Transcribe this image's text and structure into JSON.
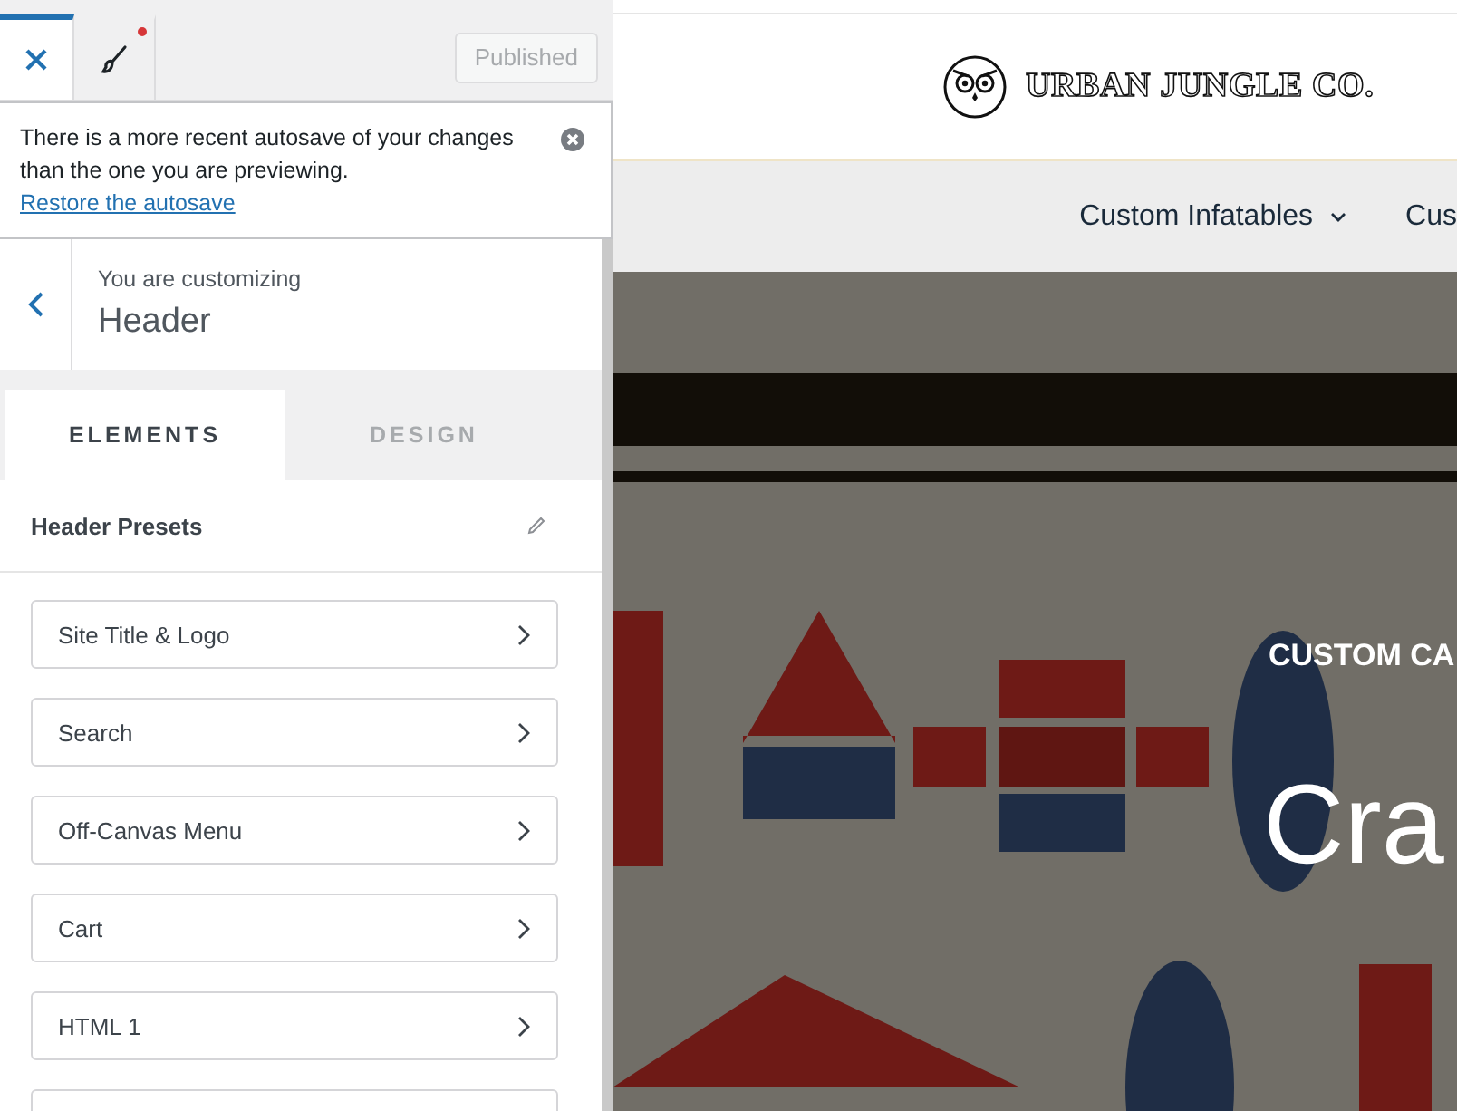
{
  "topbar": {
    "tabs": [
      {
        "kind": "close",
        "selected": true,
        "has_changes": false
      },
      {
        "kind": "brush",
        "selected": false,
        "has_changes": true
      }
    ],
    "publish_button": {
      "label": "Published",
      "disabled": true
    }
  },
  "notice": {
    "text": "There is a more recent autosave of your changes than the one you are previewing.",
    "link": "Restore the autosave"
  },
  "section": {
    "caption": "You are customizing",
    "title": "Header"
  },
  "panel_tabs": [
    {
      "label": "ELEMENTS",
      "selected": true
    },
    {
      "label": "DESIGN",
      "selected": false
    }
  ],
  "presets": {
    "label": "Header Presets"
  },
  "items": [
    {
      "label": "Site Title & Logo"
    },
    {
      "label": "Search"
    },
    {
      "label": "Off-Canvas Menu"
    },
    {
      "label": "Cart"
    },
    {
      "label": "HTML 1"
    }
  ],
  "preview": {
    "logo": "URBAN JUNGLE CO.",
    "nav": [
      {
        "label": "Custom Infatables",
        "has_dropdown": true
      },
      {
        "label": "Cus",
        "has_dropdown": false
      }
    ],
    "hero": {
      "kind": "picture",
      "eyebrow": "CUSTOM CA",
      "title": "Cra"
    }
  }
}
